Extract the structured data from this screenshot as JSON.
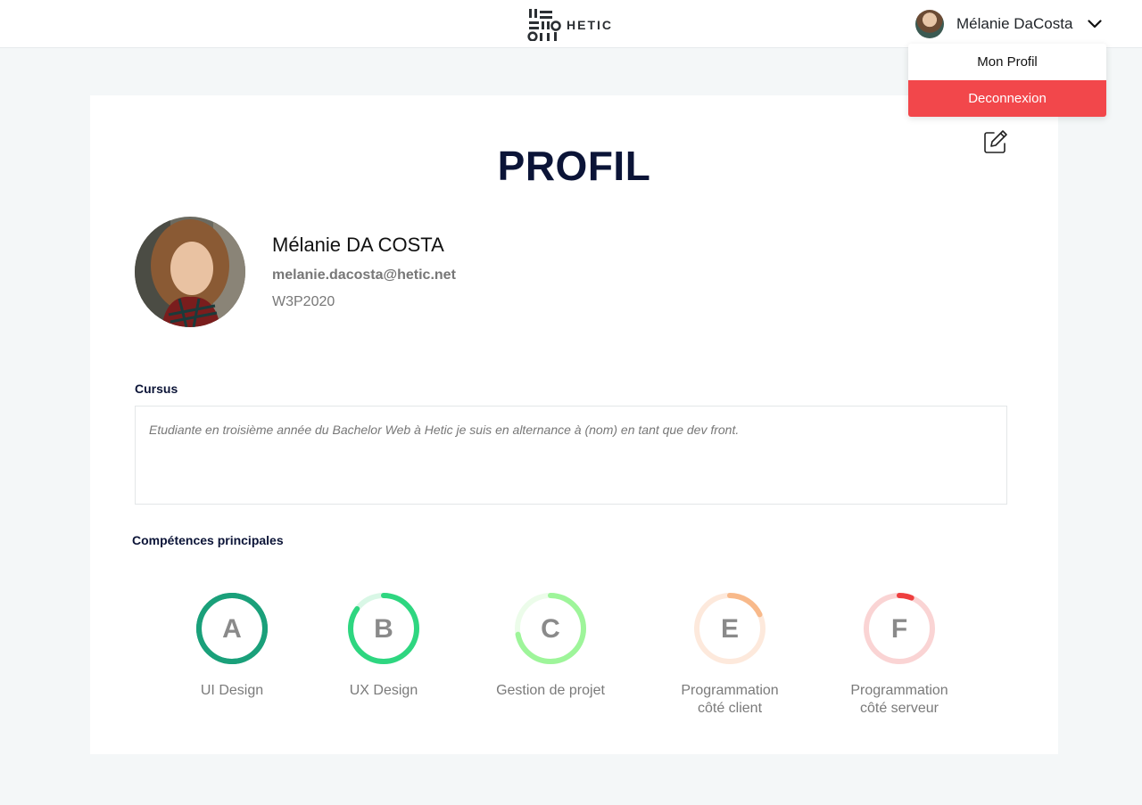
{
  "header": {
    "logo_text": "HETIC",
    "user_name": "Mélanie DaCosta"
  },
  "dropdown": {
    "items": [
      {
        "label": "Mon Profil"
      },
      {
        "label": "Deconnexion"
      }
    ]
  },
  "profile": {
    "title": "PROFIL",
    "name": "Mélanie DA COSTA",
    "email": "melanie.dacosta@hetic.net",
    "class": "W3P2020"
  },
  "cursus": {
    "label": "Cursus",
    "text": "Etudiante en troisième année du Bachelor Web à Hetic je suis en alternance à (nom) en tant que dev front."
  },
  "skills": {
    "label": "Compétences principales",
    "items": [
      {
        "grade": "A",
        "label": "UI Design",
        "progress": 1.0,
        "color": "#1aa07a",
        "track": "#1aa07a"
      },
      {
        "grade": "B",
        "label": "UX Design",
        "progress": 0.85,
        "color": "#2ed680",
        "track": "#d9f7e6"
      },
      {
        "grade": "C",
        "label": "Gestion de projet",
        "progress": 0.72,
        "color": "#9ef59a",
        "track": "#ecfcea"
      },
      {
        "grade": "E",
        "label": "Programmation\ncôté client",
        "progress": 0.18,
        "color": "#f8b98a",
        "track": "#fde9dc"
      },
      {
        "grade": "F",
        "label": "Programmation\ncôté serveur",
        "progress": 0.06,
        "color": "#ee3f3f",
        "track": "#fad4d4"
      }
    ]
  },
  "colors": {
    "accent_danger": "#f2474b",
    "title": "#0b1437"
  }
}
